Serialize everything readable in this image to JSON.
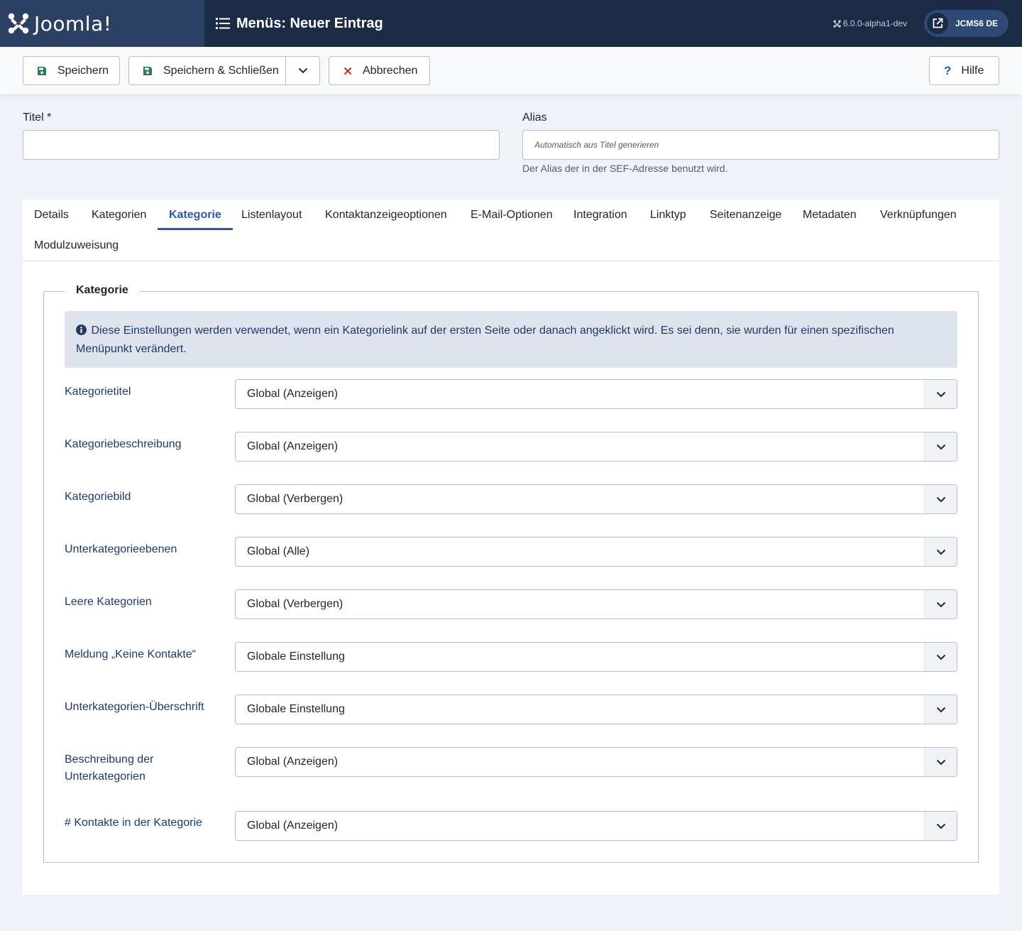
{
  "header": {
    "logo_text": "Joomla!",
    "page_title": "Menüs: Neuer Eintrag",
    "version": "6.0.0-alpha1-dev",
    "site_button": "JCMS6 DE"
  },
  "toolbar": {
    "save": "Speichern",
    "save_close": "Speichern & Schließen",
    "cancel": "Abbrechen",
    "help": "Hilfe"
  },
  "form": {
    "title_label": "Titel *",
    "title_value": "",
    "alias_label": "Alias",
    "alias_placeholder": "Automatisch aus Titel generieren",
    "alias_hint": "Der Alias der in der SEF-Adresse benutzt wird."
  },
  "tabs": [
    {
      "label": "Details"
    },
    {
      "label": "Kategorien"
    },
    {
      "label": "Kategorie"
    },
    {
      "label": "Listenlayout"
    },
    {
      "label": "Kontaktanzeigeoptionen"
    },
    {
      "label": "E-Mail-Optionen"
    },
    {
      "label": "Integration"
    },
    {
      "label": "Linktyp"
    },
    {
      "label": "Seitenanzeige"
    },
    {
      "label": "Metadaten"
    },
    {
      "label": "Verknüpfungen"
    },
    {
      "label": "Modulzuweisung"
    }
  ],
  "active_tab": "Kategorie",
  "section": {
    "legend": "Kategorie",
    "info": "Diese Einstellungen werden verwendet, wenn ein Kategorielink auf der ersten Seite oder danach angeklickt wird. Es sei denn, sie wurden für einen spezifischen Menüpunkt verändert.",
    "fields": [
      {
        "label": "Kategorietitel",
        "value": "Global (Anzeigen)"
      },
      {
        "label": "Kategoriebeschreibung",
        "value": "Global (Anzeigen)"
      },
      {
        "label": "Kategoriebild",
        "value": "Global (Verbergen)"
      },
      {
        "label": "Unterkategorieebenen",
        "value": "Global (Alle)"
      },
      {
        "label": "Leere Kategorien",
        "value": "Global (Verbergen)"
      },
      {
        "label": "Meldung „Keine Kontakte“",
        "value": "Globale Einstellung"
      },
      {
        "label": "Unterkategorien-Überschrift",
        "value": "Globale Einstellung"
      },
      {
        "label": "Beschreibung der Unterkategorien",
        "value": "Global (Anzeigen)"
      },
      {
        "label": "# Kontakte in der Kategorie",
        "value": "Global (Anzeigen)"
      }
    ]
  },
  "colors": {
    "header_bg": "#1c2b45",
    "logo_bg": "#2b4163",
    "accent": "#2a5aa6",
    "save_icon": "#2f7d4f",
    "cancel_icon": "#c52827",
    "label_text": "#1f3a66"
  }
}
